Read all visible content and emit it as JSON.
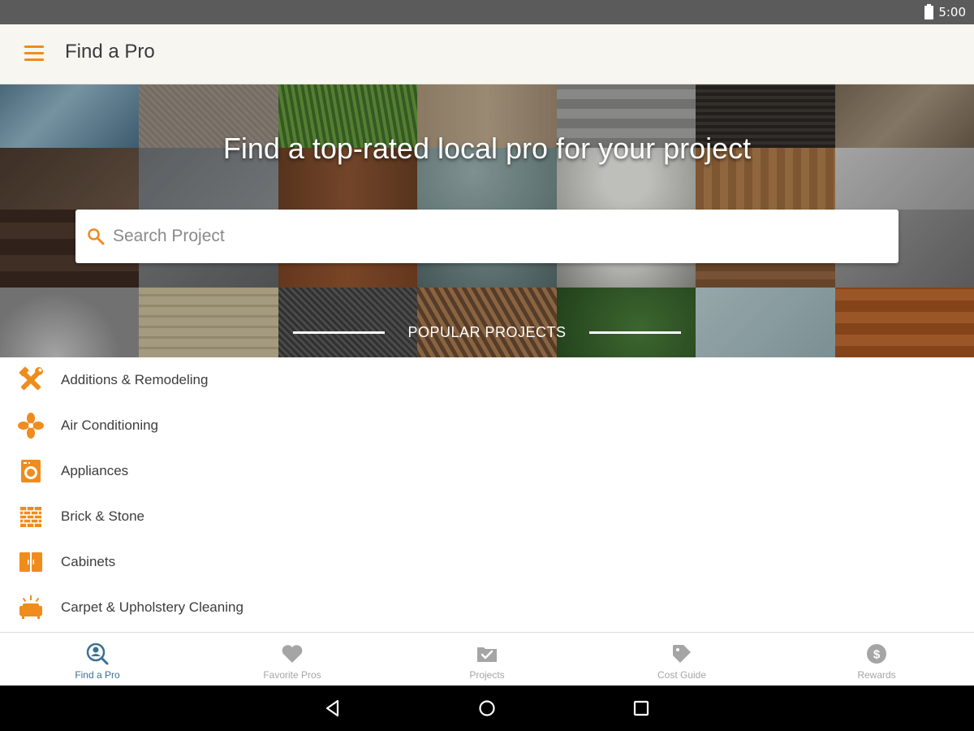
{
  "status_bar": {
    "time": "5:00"
  },
  "app_bar": {
    "title": "Find a Pro",
    "menu_icon": "hamburger-menu-icon"
  },
  "hero": {
    "headline": "Find a top-rated local pro for your project",
    "search": {
      "placeholder": "Search Project",
      "value": ""
    },
    "popular_heading": "POPULAR PROJECTS"
  },
  "projects": [
    {
      "label": "Additions & Remodeling",
      "icon": "hammer-wrench-icon"
    },
    {
      "label": "Air Conditioning",
      "icon": "fan-icon"
    },
    {
      "label": "Appliances",
      "icon": "washing-machine-icon"
    },
    {
      "label": "Brick & Stone",
      "icon": "brick-wall-icon"
    },
    {
      "label": "Cabinets",
      "icon": "cabinet-icon"
    },
    {
      "label": "Carpet & Upholstery Cleaning",
      "icon": "sofa-icon"
    }
  ],
  "bottom_nav": [
    {
      "label": "Find a Pro",
      "icon": "find-pro-icon",
      "active": true
    },
    {
      "label": "Favorite Pros",
      "icon": "heart-icon",
      "active": false
    },
    {
      "label": "Projects",
      "icon": "folder-check-icon",
      "active": false
    },
    {
      "label": "Cost Guide",
      "icon": "price-tag-icon",
      "active": false
    },
    {
      "label": "Rewards",
      "icon": "dollar-coin-icon",
      "active": false
    }
  ],
  "colors": {
    "accent": "#f08c1c",
    "nav_active": "#3b7194",
    "nav_inactive": "#a5a5a5",
    "app_bar_bg": "#f8f6f1"
  }
}
